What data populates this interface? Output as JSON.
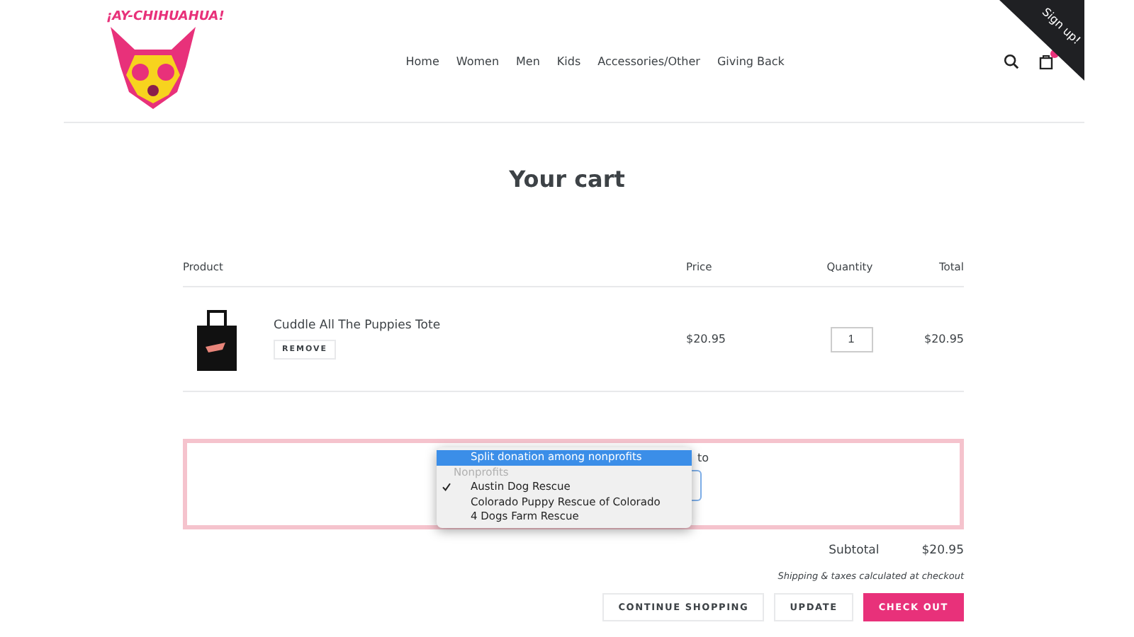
{
  "logo": {
    "text": "¡AY-CHIHUAHUA!"
  },
  "nav": [
    {
      "label": "Home"
    },
    {
      "label": "Women"
    },
    {
      "label": "Men"
    },
    {
      "label": "Kids"
    },
    {
      "label": "Accessories/Other"
    },
    {
      "label": "Giving Back"
    }
  ],
  "signup_ribbon": {
    "label": "Sign up!"
  },
  "title": "Your cart",
  "table": {
    "columns": [
      "Product",
      "Price",
      "Quantity",
      "Total"
    ],
    "rows": [
      {
        "name": "Cuddle All The Puppies Tote",
        "remove": "REMOVE",
        "price": "$20.95",
        "quantity": "1",
        "total": "$20.95"
      }
    ]
  },
  "donation": {
    "label_fragment": "to",
    "dropdown": {
      "options": [
        {
          "label": "Split donation among nonprofits",
          "kind": "option",
          "selected": false,
          "highlighted": true
        },
        {
          "label": "Nonprofits",
          "kind": "group",
          "highlighted": false
        },
        {
          "label": "Austin Dog Rescue",
          "kind": "option",
          "selected": true,
          "highlighted": false
        },
        {
          "label": "Colorado Puppy Rescue of Colorado",
          "kind": "option",
          "selected": false,
          "highlighted": false
        },
        {
          "label": "4 Dogs Farm Rescue",
          "kind": "option",
          "selected": false,
          "highlighted": false
        }
      ]
    }
  },
  "subtotal": {
    "label": "Subtotal",
    "value": "$20.95"
  },
  "shipping_note": "Shipping & taxes calculated at checkout",
  "buttons": [
    {
      "label": "CONTINUE SHOPPING",
      "kind": "secondary"
    },
    {
      "label": "UPDATE",
      "kind": "secondary"
    },
    {
      "label": "CHECK OUT",
      "kind": "primary"
    }
  ]
}
